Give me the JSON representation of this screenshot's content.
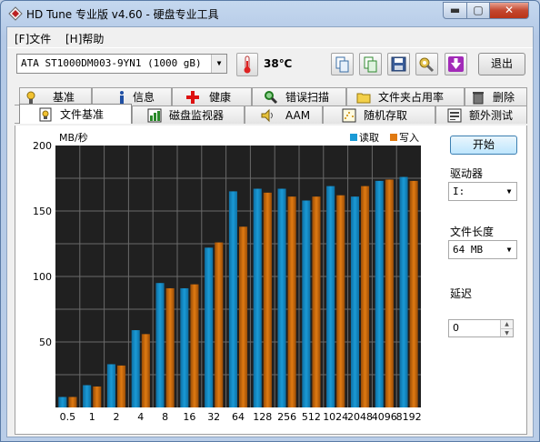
{
  "window": {
    "title": "HD Tune 专业版 v4.60 - 硬盘专业工具"
  },
  "menu": [
    {
      "label": "[F]文件"
    },
    {
      "label": "[H]帮助"
    }
  ],
  "toolbar": {
    "drive": "ATA      ST1000DM003-9YN1  (1000 gB)",
    "temperature": "38℃",
    "exit_label": "退出"
  },
  "tabs_top": [
    {
      "label": "基准",
      "icon": "gauge-icon"
    },
    {
      "label": "信息",
      "icon": "info-icon"
    },
    {
      "label": "健康",
      "icon": "health-cross-icon"
    },
    {
      "label": "错误扫描",
      "icon": "magnifier-icon"
    },
    {
      "label": "文件夹占用率",
      "icon": "folder-icon"
    },
    {
      "label": "删除",
      "icon": "trash-icon"
    }
  ],
  "tabs_bottom": [
    {
      "label": "文件基准",
      "icon": "file-benchmark-icon",
      "active": true
    },
    {
      "label": "磁盘监视器",
      "icon": "bar-chart-icon"
    },
    {
      "label": "AAM",
      "icon": "speaker-icon"
    },
    {
      "label": "随机存取",
      "icon": "random-access-icon"
    },
    {
      "label": "额外测试",
      "icon": "extra-tests-icon"
    }
  ],
  "side": {
    "start_label": "开始",
    "drive_label": "驱动器",
    "drive_value": "I:",
    "length_label": "文件长度",
    "length_value": "64 MB",
    "delay_label": "延迟",
    "delay_value": "0"
  },
  "colors": {
    "read": "#1a9ad6",
    "write": "#e07a12",
    "plot_bg": "#202020",
    "grid": "#6a6a6a"
  },
  "chart_data": {
    "type": "bar",
    "ylabel": "MB/秒",
    "ylim": [
      0,
      200
    ],
    "yticks": [
      50,
      100,
      150,
      200
    ],
    "categories": [
      "0.5",
      "1",
      "2",
      "4",
      "8",
      "16",
      "32",
      "64",
      "128",
      "256",
      "512",
      "1024",
      "2048",
      "4096",
      "8192"
    ],
    "series": [
      {
        "name": "读取",
        "values": [
          8,
          17,
          33,
          59,
          95,
          91,
          122,
          165,
          167,
          167,
          158,
          169,
          161,
          173,
          176
        ]
      },
      {
        "name": "写入",
        "values": [
          8,
          16,
          32,
          56,
          91,
          94,
          126,
          138,
          164,
          161,
          161,
          162,
          169,
          174,
          173
        ]
      }
    ],
    "grid": true,
    "legend": "top-right"
  }
}
